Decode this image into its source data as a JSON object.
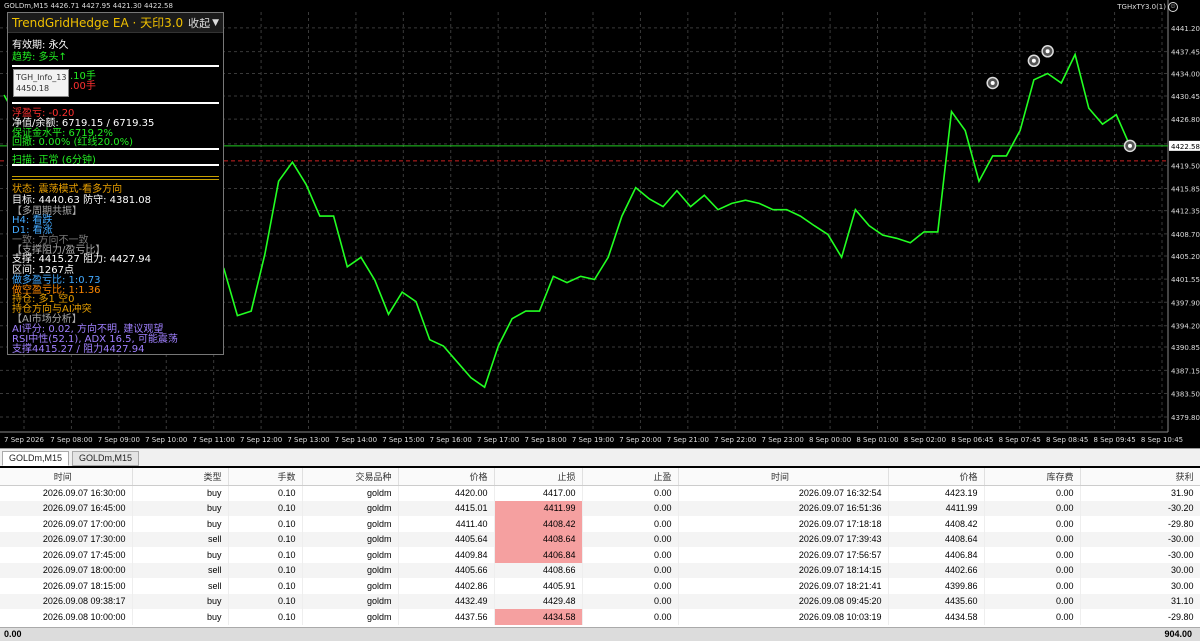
{
  "chart": {
    "symbol_header": "GOLDm,M15  4426.71 4427.95 4421.30 4422.58",
    "ea_label": "TGHxTY3.0(1)",
    "smiley": "☺",
    "current_price": "4422.58",
    "colors": {
      "line": "#22ff22",
      "grid": "#3a3a3a",
      "current": "#22cc22",
      "ref": "#cc2222",
      "bg": "#000000"
    }
  },
  "chart_data": {
    "type": "line",
    "title": "",
    "xlabel": "",
    "ylabel": "",
    "ylim": [
      4377.43,
      4443.7
    ],
    "y_ticks": [
      "4441.20",
      "4437.45",
      "4434.00",
      "4430.45",
      "4426.80",
      "4422.90",
      "4419.50",
      "4415.85",
      "4412.35",
      "4408.70",
      "4405.20",
      "4401.55",
      "4397.90",
      "4394.20",
      "4390.85",
      "4387.15",
      "4383.50",
      "4379.80"
    ],
    "x_ticks": [
      "7 Sep 2026",
      "7 Sep 08:00",
      "7 Sep 09:00",
      "7 Sep 10:00",
      "7 Sep 11:00",
      "7 Sep 12:00",
      "7 Sep 13:00",
      "7 Sep 14:00",
      "7 Sep 15:00",
      "7 Sep 16:00",
      "7 Sep 17:00",
      "7 Sep 18:00",
      "7 Sep 19:00",
      "7 Sep 20:00",
      "7 Sep 21:00",
      "7 Sep 22:00",
      "7 Sep 23:00",
      "8 Sep 00:00",
      "8 Sep 01:00",
      "8 Sep 02:00",
      "8 Sep 06:45",
      "8 Sep 07:45",
      "8 Sep 08:45",
      "8 Sep 09:45",
      "8 Sep 10:45"
    ],
    "series": [
      {
        "values": [
          4430.6,
          4426.8,
          4421.0,
          4410.5,
          4405.5,
          4402.3,
          4404.8,
          4401.2,
          4405.6,
          4413.0,
          4400.9,
          4395.9,
          4392.5,
          4395.0,
          4397.0,
          4392.5,
          4403.3,
          4395.8,
          4396.5,
          4405.5,
          4417.0,
          4420.0,
          4416.5,
          4411.5,
          4411.5,
          4403.5,
          4405.0,
          4401.4,
          4396.0,
          4399.5,
          4398.0,
          4392.0,
          4391.0,
          4388.5,
          4386.0,
          4384.5,
          4391.0,
          4395.3,
          4396.5,
          4396.5,
          4402.0,
          4401.0,
          4402.0,
          4401.5,
          4405.0,
          4411.5,
          4416.0,
          4414.2,
          4413.0,
          4415.5,
          4413.0,
          4414.8,
          4412.5,
          4413.5,
          4414.0,
          4413.5,
          4412.5,
          4412.5,
          4411.5,
          4410.0,
          4408.6,
          4405.0,
          4412.5,
          4410.0,
          4408.5,
          4408.0,
          4407.3,
          4409.0,
          4409.0,
          4428.0,
          4425.0,
          4417.0,
          4421.0,
          4421.0,
          4425.0,
          4433.0,
          4434.0,
          4432.5,
          4437.0,
          4428.5,
          4426.0,
          4427.5,
          4422.58
        ]
      }
    ],
    "markers": [
      4432.5,
      4436.0,
      4437.5,
      4422.58
    ]
  },
  "panel": {
    "title": "TrendGridHedge EA · 天印3.0",
    "collapse": "收起",
    "arrow": "▼",
    "lines": [
      {
        "text": "有效期: 永久",
        "color": "#ffffff"
      },
      {
        "text": "趋势: 多头↑",
        "color": "#22ee22"
      },
      {
        "text": "TGH_Info_13",
        "color": "#555555"
      },
      {
        "text": "4450.18",
        "color": "#555555"
      },
      {
        "text": ".10手",
        "color": "#22ee22"
      },
      {
        "text": ".00手",
        "color": "#ff3030"
      },
      {
        "text": "浮盈亏: -0.20",
        "color": "#ff3030"
      },
      {
        "text": "净值/余额: 6719.15 / 6719.35",
        "color": "#ffffff"
      },
      {
        "text": "保证金水平: 6719.2%",
        "color": "#22ee22"
      },
      {
        "text": "回撤: 0.00% (红线20.0%)",
        "color": "#22ee22"
      },
      {
        "text": "扫描: 正常 (6分钟)",
        "color": "#22ee22"
      },
      {
        "text": "状态: 震荡模式-看多方向",
        "color": "#e8a000"
      },
      {
        "text": "目标: 4440.63  防守: 4381.08",
        "color": "#ffffff"
      },
      {
        "text": "【多周期共振】",
        "color": "#aaaaaa"
      },
      {
        "text": "H4: 看跌",
        "color": "#44aaff"
      },
      {
        "text": "D1: 看涨",
        "color": "#44aaff"
      },
      {
        "text": "一致: 方向不一致",
        "color": "#777777"
      },
      {
        "text": "【支撑阻力/盈亏比】",
        "color": "#aaaaaa"
      },
      {
        "text": "支撑: 4415.27  阻力: 4427.94",
        "color": "#ffffff"
      },
      {
        "text": "区间: 1267点",
        "color": "#ffffff"
      },
      {
        "text": "做多盈亏比: 1:0.73",
        "color": "#44aaff"
      },
      {
        "text": "做空盈亏比: 1:1.36",
        "color": "#ff8800"
      },
      {
        "text": "持仓: 多1 空0",
        "color": "#e8a000"
      },
      {
        "text": "持仓方向与AI冲突",
        "color": "#e8a000"
      },
      {
        "text": "【AI市场分析】",
        "color": "#aaaaaa"
      },
      {
        "text": "AI评分: 0.02, 方向不明, 建议观望",
        "color": "#a080ff"
      },
      {
        "text": "RSI中性(52.1), ADX 16.5, 可能震荡",
        "color": "#a080ff"
      },
      {
        "text": "支撑4415.27 / 阻力4427.94",
        "color": "#a080ff"
      }
    ]
  },
  "tabs": [
    "GOLDm,M15",
    "GOLDm,M15"
  ],
  "table": {
    "headers": [
      "时间",
      "类型",
      "手数",
      "交易品种",
      "价格",
      "止损",
      "止盈",
      "时间",
      "价格",
      "库存费",
      "获利"
    ],
    "rows": [
      {
        "open_time": "2026.09.07 16:30:00",
        "type": "buy",
        "lots": "0.10",
        "symbol": "goldm",
        "price": "4420.00",
        "sl": "4417.00",
        "tp": "0.00",
        "close_time": "2026.09.07 16:32:54",
        "close_price": "4423.19",
        "swap": "0.00",
        "profit": "31.90",
        "sl_hit": false
      },
      {
        "open_time": "2026.09.07 16:45:00",
        "type": "buy",
        "lots": "0.10",
        "symbol": "goldm",
        "price": "4415.01",
        "sl": "4411.99",
        "tp": "0.00",
        "close_time": "2026.09.07 16:51:36",
        "close_price": "4411.99",
        "swap": "0.00",
        "profit": "-30.20",
        "sl_hit": true
      },
      {
        "open_time": "2026.09.07 17:00:00",
        "type": "buy",
        "lots": "0.10",
        "symbol": "goldm",
        "price": "4411.40",
        "sl": "4408.42",
        "tp": "0.00",
        "close_time": "2026.09.07 17:18:18",
        "close_price": "4408.42",
        "swap": "0.00",
        "profit": "-29.80",
        "sl_hit": true
      },
      {
        "open_time": "2026.09.07 17:30:00",
        "type": "sell",
        "lots": "0.10",
        "symbol": "goldm",
        "price": "4405.64",
        "sl": "4408.64",
        "tp": "0.00",
        "close_time": "2026.09.07 17:39:43",
        "close_price": "4408.64",
        "swap": "0.00",
        "profit": "-30.00",
        "sl_hit": true
      },
      {
        "open_time": "2026.09.07 17:45:00",
        "type": "buy",
        "lots": "0.10",
        "symbol": "goldm",
        "price": "4409.84",
        "sl": "4406.84",
        "tp": "0.00",
        "close_time": "2026.09.07 17:56:57",
        "close_price": "4406.84",
        "swap": "0.00",
        "profit": "-30.00",
        "sl_hit": true
      },
      {
        "open_time": "2026.09.07 18:00:00",
        "type": "sell",
        "lots": "0.10",
        "symbol": "goldm",
        "price": "4405.66",
        "sl": "4408.66",
        "tp": "0.00",
        "close_time": "2026.09.07 18:14:15",
        "close_price": "4402.66",
        "swap": "0.00",
        "profit": "30.00",
        "sl_hit": false
      },
      {
        "open_time": "2026.09.07 18:15:00",
        "type": "sell",
        "lots": "0.10",
        "symbol": "goldm",
        "price": "4402.86",
        "sl": "4405.91",
        "tp": "0.00",
        "close_time": "2026.09.07 18:21:41",
        "close_price": "4399.86",
        "swap": "0.00",
        "profit": "30.00",
        "sl_hit": false
      },
      {
        "open_time": "2026.09.08 09:38:17",
        "type": "buy",
        "lots": "0.10",
        "symbol": "goldm",
        "price": "4432.49",
        "sl": "4429.48",
        "tp": "0.00",
        "close_time": "2026.09.08 09:45:20",
        "close_price": "4435.60",
        "swap": "0.00",
        "profit": "31.10",
        "sl_hit": false
      },
      {
        "open_time": "2026.09.08 10:00:00",
        "type": "buy",
        "lots": "0.10",
        "symbol": "goldm",
        "price": "4437.56",
        "sl": "4434.58",
        "tp": "0.00",
        "close_time": "2026.09.08 10:03:19",
        "close_price": "4434.58",
        "swap": "0.00",
        "profit": "-29.80",
        "sl_hit": true
      }
    ],
    "total_left": "0.00",
    "total_right": "904.00"
  }
}
